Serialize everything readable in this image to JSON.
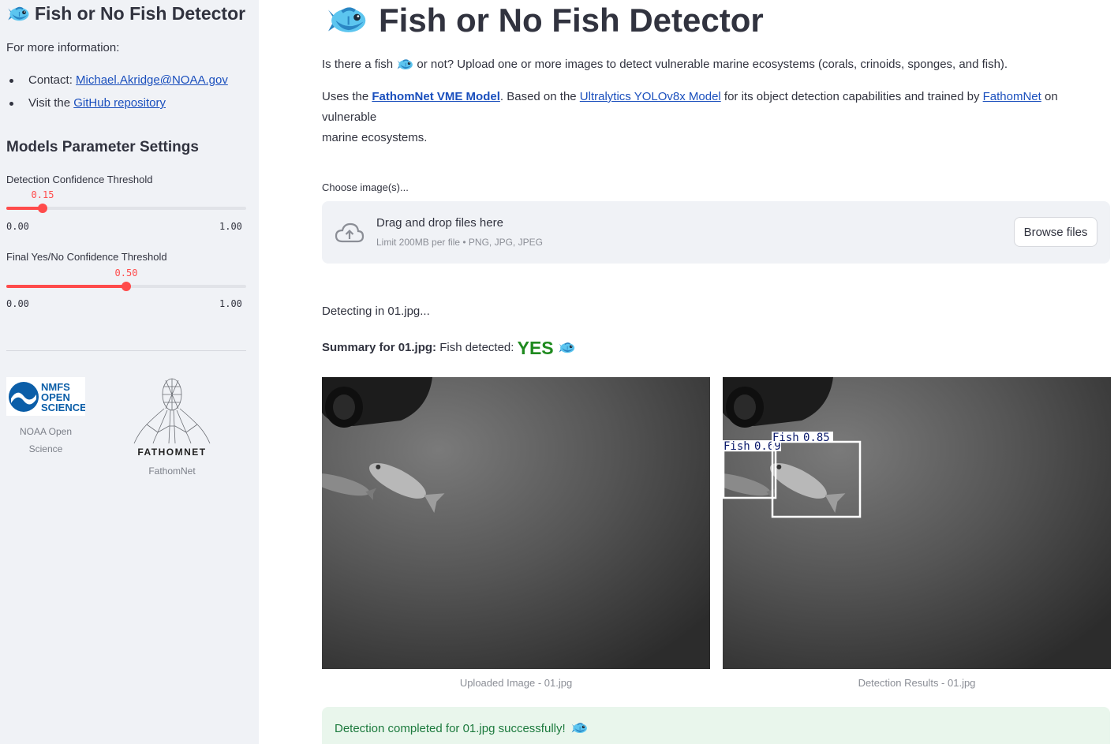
{
  "sidebar": {
    "title": "Fish or No Fish Detector",
    "info_label": "For more information:",
    "contact_prefix": "Contact: ",
    "contact_link": "Michael.Akridge@NOAA.gov",
    "visit_prefix": "Visit the ",
    "github_link": "GitHub repository",
    "settings_heading": "Models Parameter Settings",
    "slider1": {
      "label": "Detection Confidence Threshold",
      "value_text": "0.15",
      "value": 0.15,
      "min_text": "0.00",
      "max_text": "1.00"
    },
    "slider2": {
      "label": "Final Yes/No Confidence Threshold",
      "value_text": "0.50",
      "value": 0.5,
      "min_text": "0.00",
      "max_text": "1.00"
    },
    "logos": [
      {
        "caption_line1": "NOAA Open",
        "caption_line2": "Science",
        "text_lines": [
          "NMFS",
          "OPEN",
          "SCIENCE"
        ]
      },
      {
        "caption": "FathomNet",
        "wordmark": "FATHOMNET"
      }
    ]
  },
  "main": {
    "title": "Fish or No Fish Detector",
    "intro_a": "Is there a fish ",
    "intro_b": " or not? Upload one or more images to detect vulnerable marine ecosystems (corals, crinoids, sponges, and fish).",
    "uses_prefix": "Uses the ",
    "model_link": "FathomNet VME Model",
    "based_on": ". Based on the ",
    "yolo_link": "Ultralytics YOLOv8x Model",
    "trained_by": " for its object detection capabilities and trained by ",
    "fathomnet_link": "FathomNet",
    "on_vuln_1": " on vulnerable",
    "on_vuln_2": "marine ecosystems.",
    "uploader": {
      "label": "Choose image(s)...",
      "drag_text": "Drag and drop files here",
      "limit_text": "Limit 200MB per file • PNG, JPG, JPEG",
      "browse_label": "Browse files"
    },
    "detecting_text": "Detecting in 01.jpg...",
    "summary_prefix": "Summary for 01.jpg:",
    "summary_mid": " Fish detected: ",
    "summary_result": "YES",
    "detections": [
      {
        "label": "Fish",
        "confidence": "0.69"
      },
      {
        "label": "Fish",
        "confidence": "0.85"
      }
    ],
    "caption_uploaded": "Uploaded Image - 01.jpg",
    "caption_results": "Detection Results - 01.jpg",
    "success_text": "Detection completed for 01.jpg successfully!"
  },
  "colors": {
    "accent": "#ff4b4b",
    "link": "#1a4fbd",
    "success_bg": "#e9f6ec",
    "yes": "#1f8a1f"
  },
  "icons": [
    "fish-emoji-icon",
    "cloud-upload-icon"
  ]
}
